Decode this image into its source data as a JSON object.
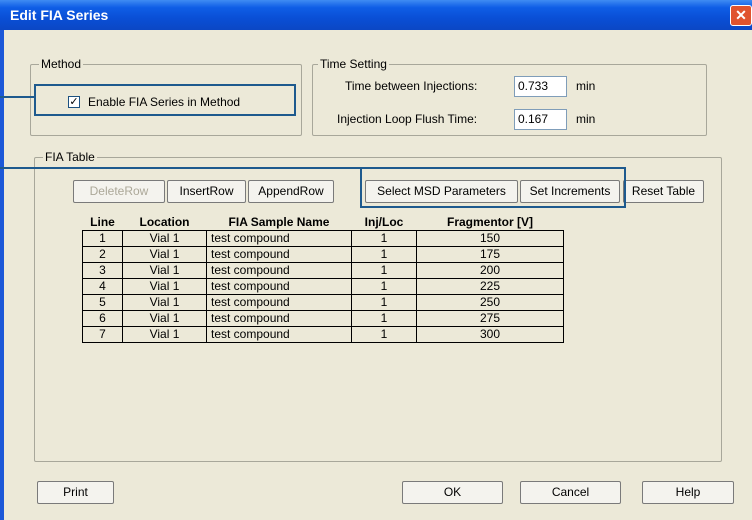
{
  "window": {
    "title": "Edit FIA Series",
    "close": "✕"
  },
  "method": {
    "legend": "Method",
    "enable_label": "Enable FIA Series in Method",
    "enable_checked": "✓"
  },
  "time_setting": {
    "legend": "Time Setting",
    "between_label": "Time between Injections:",
    "between_value": "0.733",
    "between_unit": "min",
    "flush_label": "Injection Loop Flush Time:",
    "flush_value": "0.167",
    "flush_unit": "min"
  },
  "fia_table": {
    "legend": "FIA Table",
    "buttons": {
      "delete_row": "DeleteRow",
      "insert_row": "InsertRow",
      "append_row": "AppendRow",
      "select_msd": "Select MSD Parameters",
      "set_increments": "Set Increments",
      "reset_table": "Reset Table"
    },
    "columns": [
      "Line",
      "Location",
      "FIA Sample Name",
      "Inj/Loc",
      "Fragmentor [V]"
    ],
    "rows": [
      [
        "1",
        "Vial 1",
        "test compound",
        "1",
        "150"
      ],
      [
        "2",
        "Vial 1",
        "test compound",
        "1",
        "175"
      ],
      [
        "3",
        "Vial 1",
        "test compound",
        "1",
        "200"
      ],
      [
        "4",
        "Vial 1",
        "test compound",
        "1",
        "225"
      ],
      [
        "5",
        "Vial 1",
        "test compound",
        "1",
        "250"
      ],
      [
        "6",
        "Vial 1",
        "test compound",
        "1",
        "275"
      ],
      [
        "7",
        "Vial 1",
        "test compound",
        "1",
        "300"
      ]
    ]
  },
  "footer": {
    "print": "Print",
    "ok": "OK",
    "cancel": "Cancel",
    "help": "Help"
  }
}
